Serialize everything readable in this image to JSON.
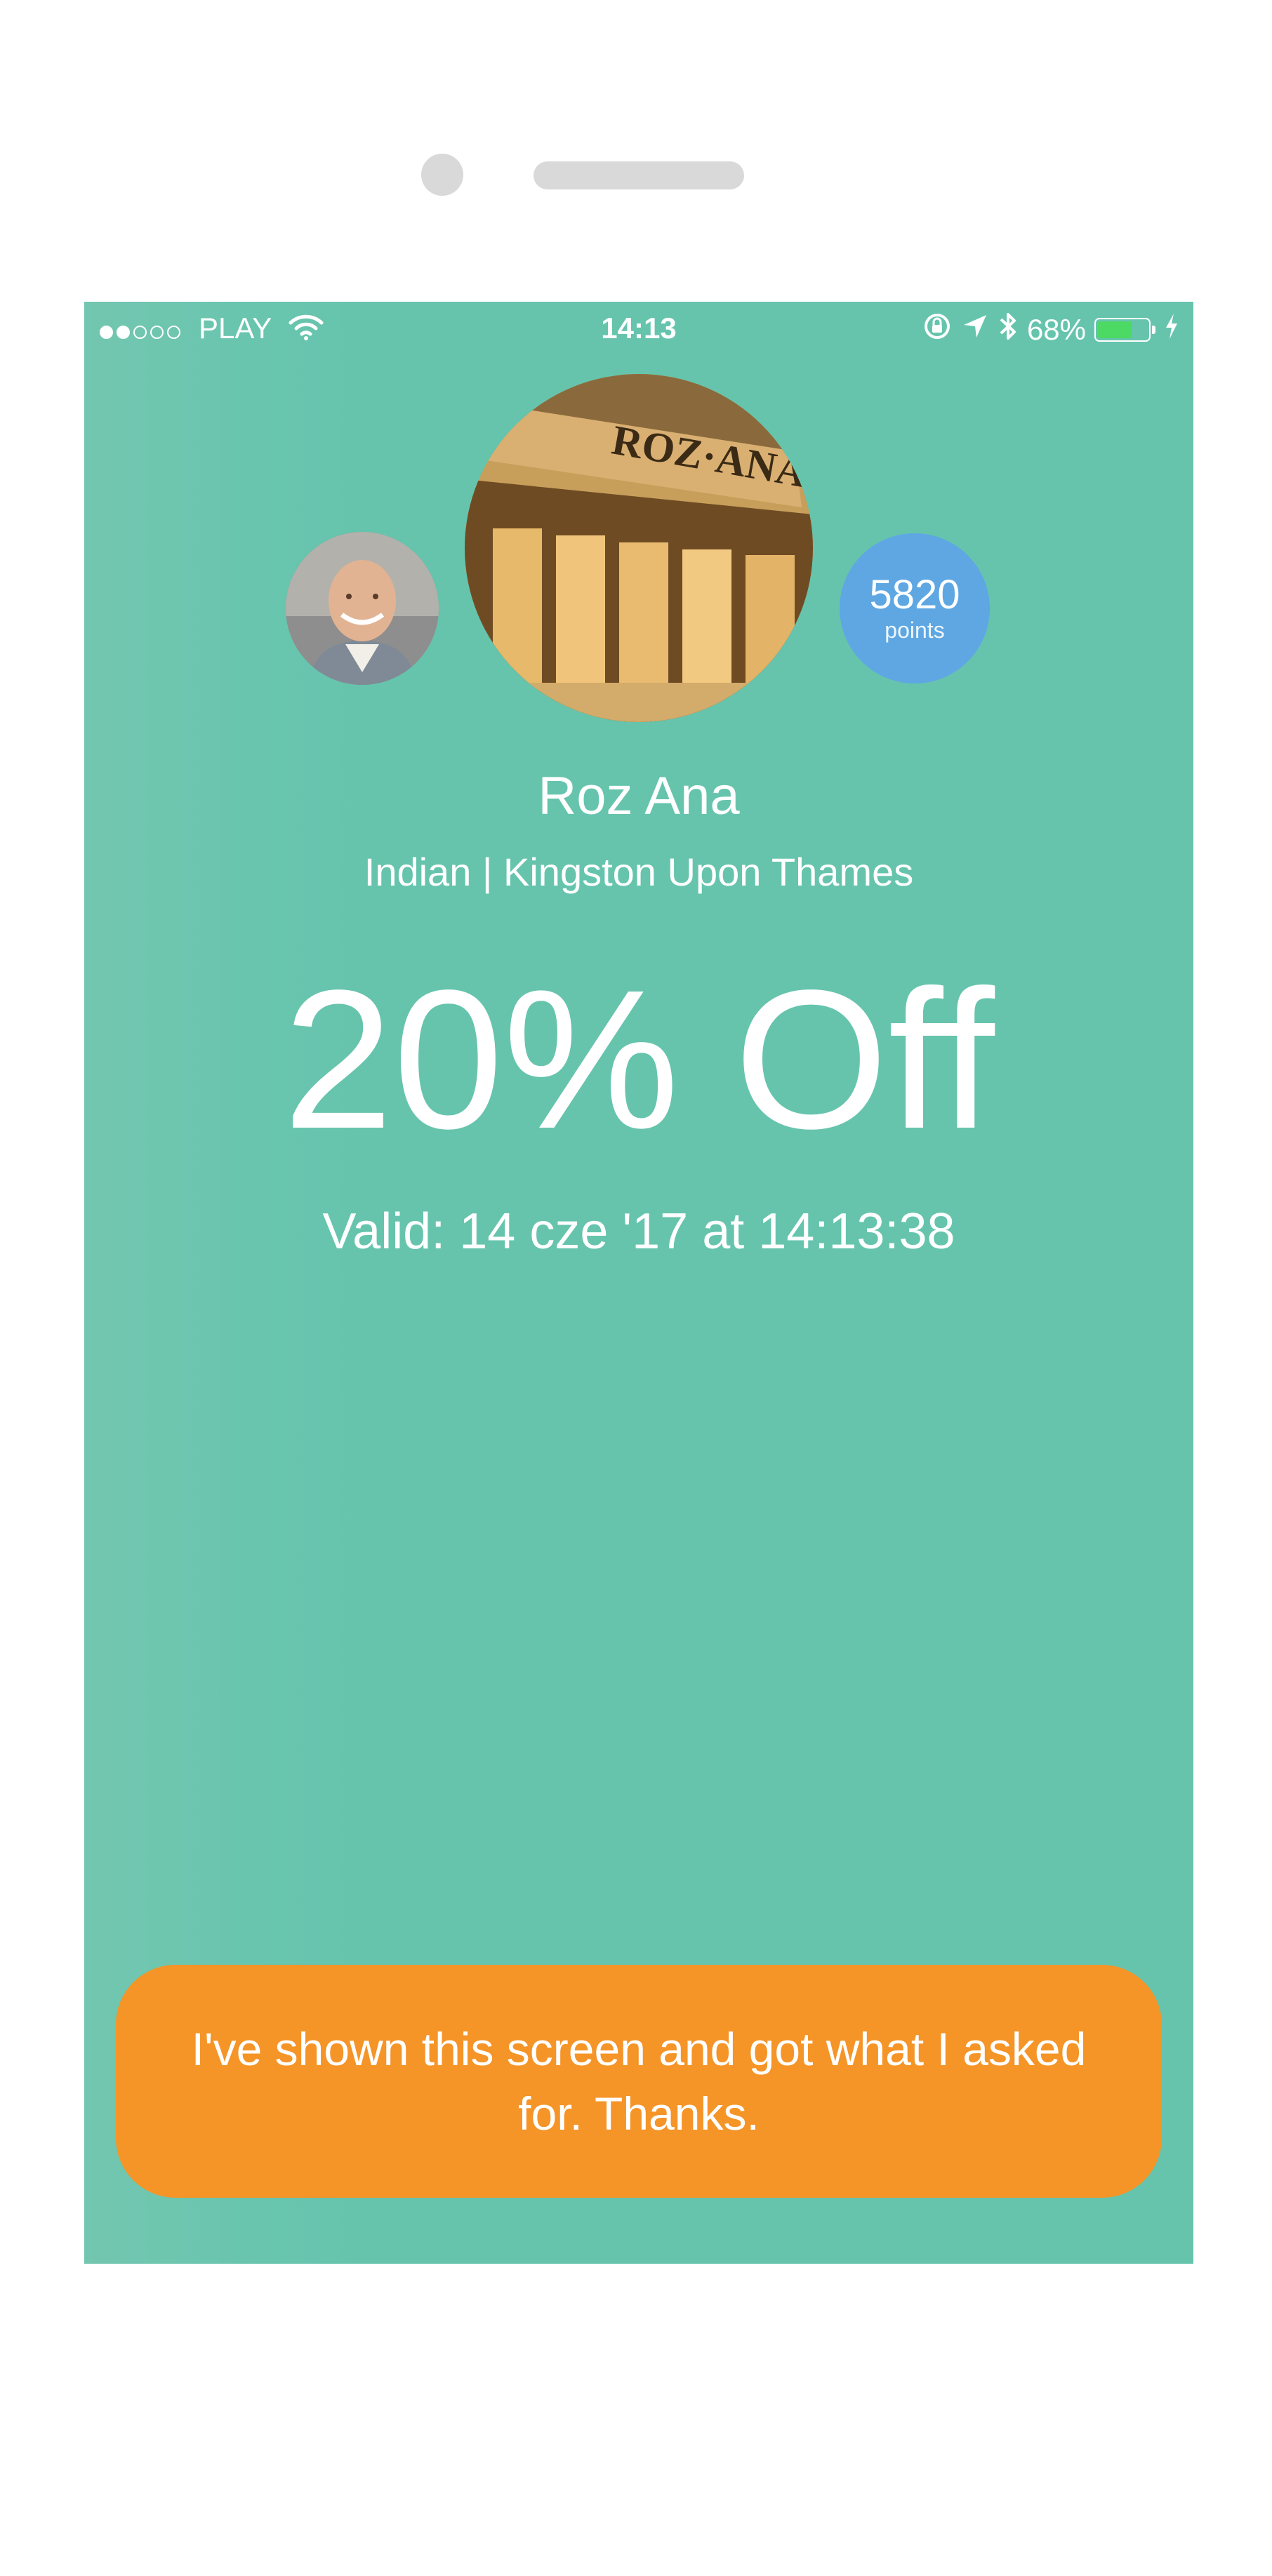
{
  "status_bar": {
    "carrier": "PLAY",
    "signal_strength": "2 of 5",
    "time": "14:13",
    "battery_percent": "68%",
    "icons": [
      "wifi-icon",
      "orientation-lock-icon",
      "location-arrow-icon",
      "bluetooth-icon",
      "battery-icon",
      "charging-bolt-icon"
    ]
  },
  "profile": {
    "avatar_icon": "user-avatar-photo",
    "venue_photo_icon": "restaurant-storefront-photo",
    "venue_photo_sign": "ROZ·ANA",
    "points_value": "5820",
    "points_label": "points"
  },
  "venue": {
    "name": "Roz Ana",
    "info": "Indian | Kingston Upon Thames"
  },
  "offer": {
    "title": "20% Off",
    "validity": "Valid: 14 cze '17 at 14:13:38"
  },
  "actions": {
    "confirm_label": "I've shown this screen and got what I asked for. Thanks."
  },
  "colors": {
    "screen_background": "#66c4ad",
    "points_badge": "#5ea7e3",
    "confirm_button": "#f59427",
    "battery_fill": "#4cd964"
  }
}
